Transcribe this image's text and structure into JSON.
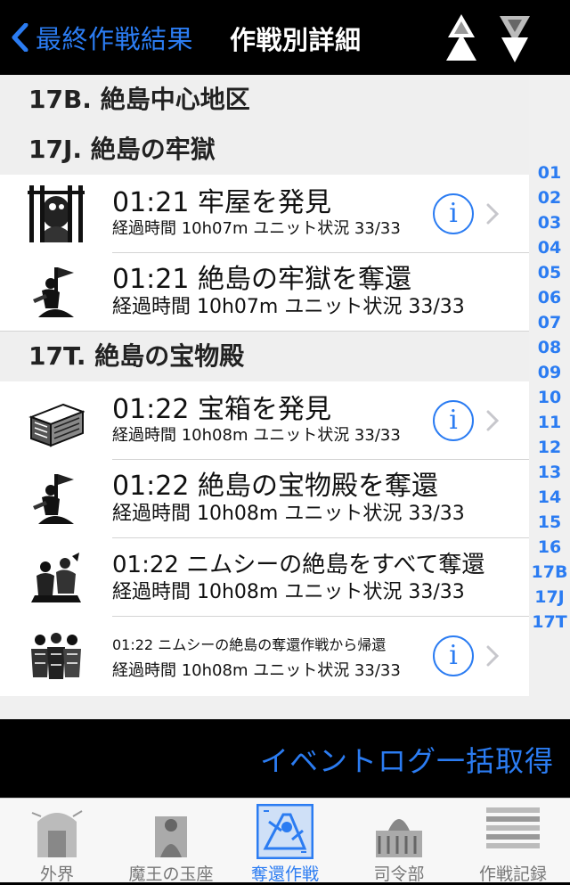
{
  "nav": {
    "back_label": "最終作戦結果",
    "title": "作戦別詳細",
    "up_icon": "double-up-arrow-icon",
    "down_icon": "double-down-arrow-icon"
  },
  "sections": [
    {
      "header": "17B. 絶島中心地区",
      "rows": []
    },
    {
      "header": "17J. 絶島の牢獄",
      "rows": [
        {
          "title": "01:21 牢屋を発見",
          "sub": "経過時間 10h07m  ユニット状況 33/33",
          "icon": "prisoner-cell-icon",
          "has_info": true
        },
        {
          "title": "01:21 絶島の牢獄を奪還",
          "sub": "経過時間 10h07m  ユニット状況 33/33",
          "icon": "soldier-flag-icon",
          "has_info": false
        }
      ]
    },
    {
      "header": "17T. 絶島の宝物殿",
      "rows": [
        {
          "title": "01:22 宝箱を発見",
          "sub": "経過時間 10h08m  ユニット状況 33/33",
          "icon": "treasure-chest-icon",
          "has_info": true
        },
        {
          "title": "01:22 絶島の宝物殿を奪還",
          "sub": "経過時間 10h08m  ユニット状況 33/33",
          "icon": "soldier-flag-icon",
          "has_info": false
        },
        {
          "title": "01:22 ニムシーの絶島をすべて奪還",
          "sub": "経過時間 10h08m  ユニット状況 33/33",
          "icon": "battle-group-icon",
          "has_info": false
        },
        {
          "title": "01:22 ニムシーの絶島の奪還作戦から帰還",
          "sub": "経過時間 10h08m  ユニット状況 33/33",
          "icon": "returning-troops-icon",
          "has_info": true
        }
      ]
    }
  ],
  "index": [
    "01",
    "02",
    "03",
    "04",
    "05",
    "06",
    "07",
    "08",
    "09",
    "10",
    "11",
    "12",
    "13",
    "14",
    "15",
    "16",
    "17B",
    "17J",
    "17T"
  ],
  "action_label": "イベントログ一括取得",
  "tabs": [
    {
      "label": "外界",
      "icon": "outer-world-icon",
      "active": false
    },
    {
      "label": "魔王の玉座",
      "icon": "throne-icon",
      "active": false
    },
    {
      "label": "奪還作戦",
      "icon": "recapture-operation-icon",
      "active": true
    },
    {
      "label": "司令部",
      "icon": "headquarters-icon",
      "active": false
    },
    {
      "label": "作戦記録",
      "icon": "operation-log-icon",
      "active": false
    }
  ],
  "colors": {
    "accent": "#2b7cf2",
    "bar": "#000000",
    "section_bg": "#efefef"
  }
}
